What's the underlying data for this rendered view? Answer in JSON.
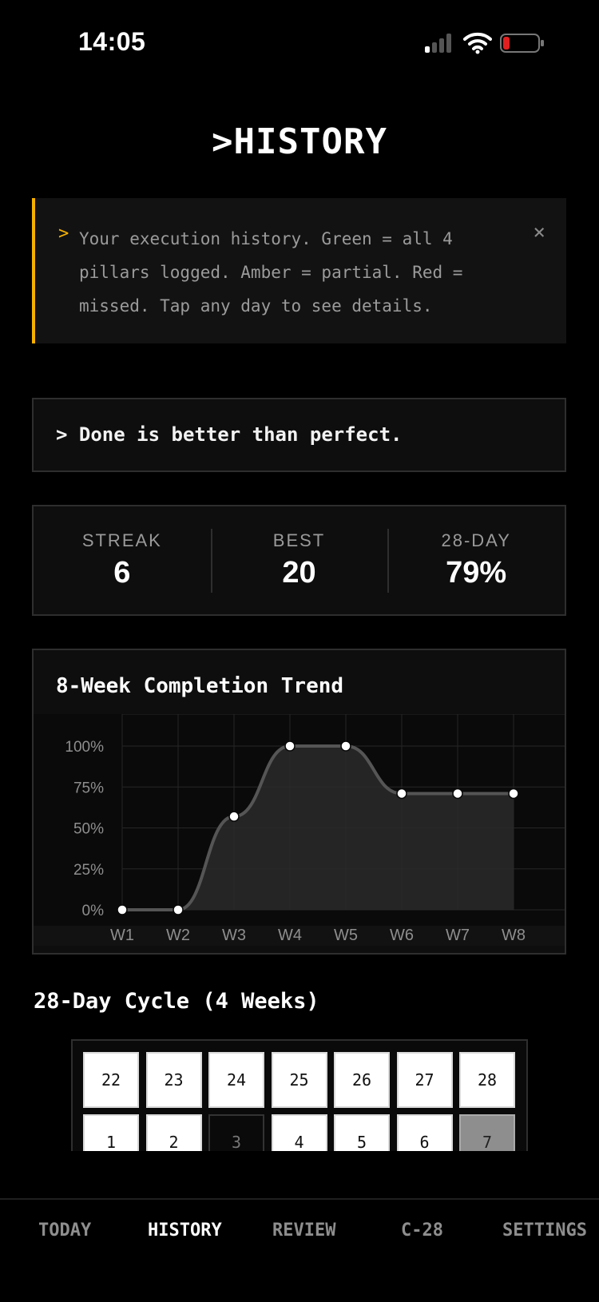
{
  "status_bar": {
    "time": "14:05",
    "battery_color": "#e02020"
  },
  "header": {
    "title": ">HISTORY"
  },
  "info_banner": {
    "chevron": ">",
    "text": "Your execution history. Green = all 4 pillars logged. Amber = partial. Red = missed. Tap any day to see details.",
    "close": "×",
    "accent_color": "#f5b000"
  },
  "quote": {
    "text": "> Done is better than perfect."
  },
  "stats": [
    {
      "label": "STREAK",
      "value": "6"
    },
    {
      "label": "BEST",
      "value": "20"
    },
    {
      "label": "28-DAY",
      "value": "79%"
    }
  ],
  "chart_data": {
    "type": "line",
    "title": "8-Week Completion Trend",
    "x": [
      "W1",
      "W2",
      "W3",
      "W4",
      "W5",
      "W6",
      "W7",
      "W8"
    ],
    "values": [
      0,
      0,
      57,
      100,
      100,
      71,
      71,
      71
    ],
    "y_ticks": [
      "100%",
      "75%",
      "50%",
      "25%",
      "0%"
    ],
    "ylim": [
      0,
      100
    ],
    "grid": true,
    "area_fill": true
  },
  "cycle": {
    "title": "28-Day Cycle (4 Weeks)",
    "rows": [
      [
        {
          "day": "22",
          "state": "filled"
        },
        {
          "day": "23",
          "state": "filled"
        },
        {
          "day": "24",
          "state": "filled"
        },
        {
          "day": "25",
          "state": "filled"
        },
        {
          "day": "26",
          "state": "filled"
        },
        {
          "day": "27",
          "state": "filled"
        },
        {
          "day": "28",
          "state": "filled"
        }
      ],
      [
        {
          "day": "1",
          "state": "filled"
        },
        {
          "day": "2",
          "state": "filled"
        },
        {
          "day": "3",
          "state": "empty"
        },
        {
          "day": "4",
          "state": "filled"
        },
        {
          "day": "5",
          "state": "filled"
        },
        {
          "day": "6",
          "state": "filled"
        },
        {
          "day": "7",
          "state": "today"
        }
      ]
    ]
  },
  "tabbar": {
    "tabs": [
      {
        "label": "TODAY",
        "active": false
      },
      {
        "label": "HISTORY",
        "active": true
      },
      {
        "label": "REVIEW",
        "active": false
      },
      {
        "label": "C-28",
        "active": false
      },
      {
        "label": "SETTINGS",
        "active": false
      }
    ]
  }
}
